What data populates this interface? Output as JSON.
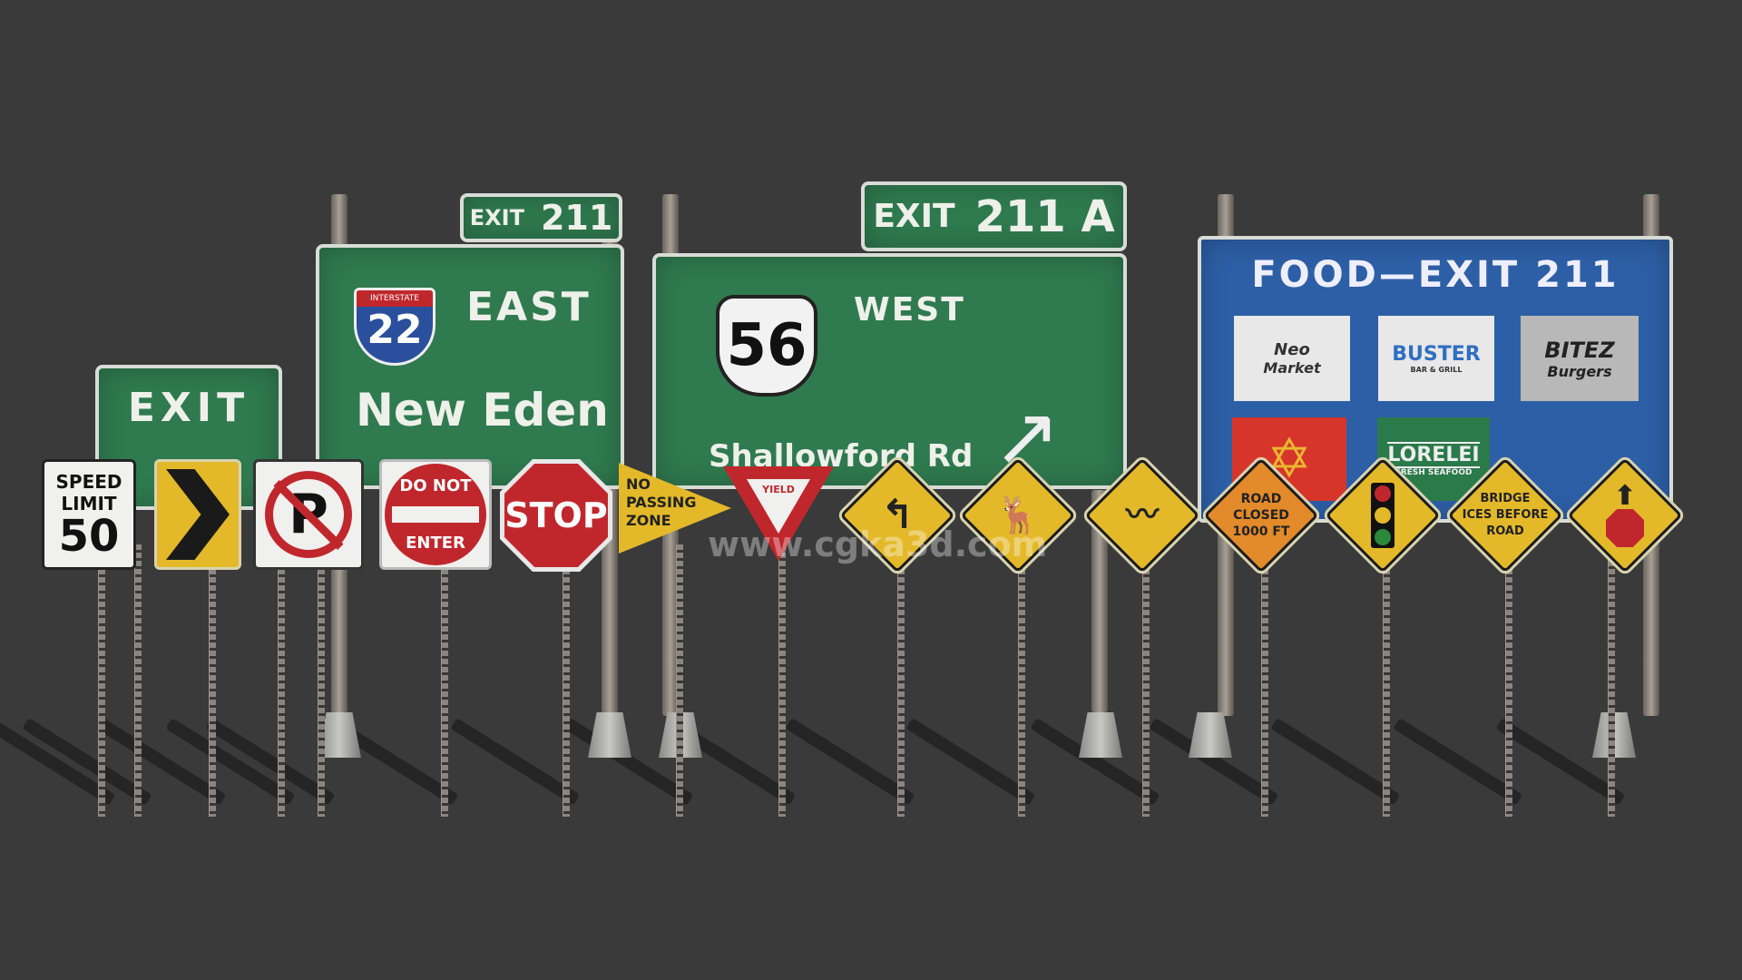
{
  "signs": {
    "exit_small": "EXIT",
    "east": {
      "tab": "EXIT",
      "tab_num": "211",
      "shield_top": "INTERSTATE",
      "shield_num": "22",
      "direction": "EAST",
      "destination": "New Eden"
    },
    "west": {
      "tab": "EXIT",
      "tab_num": "211 A",
      "shield_num": "56",
      "direction": "WEST",
      "destination": "Shallowford Rd"
    },
    "food": {
      "title": "FOOD—EXIT 211",
      "logos": [
        {
          "name": "Neo",
          "sub": "Market"
        },
        {
          "name": "BUSTER",
          "sub": "BAR & GRILL"
        },
        {
          "name": "BITEZ",
          "sub": "Burgers"
        },
        {
          "name": "",
          "sub": ""
        },
        {
          "name": "LORELEI",
          "sub": "FRESH SEAFOOD"
        }
      ]
    },
    "speed": {
      "line1": "SPEED",
      "line2": "LIMIT",
      "value": "50"
    },
    "no_parking": "P",
    "do_not_enter": {
      "line1": "DO NOT",
      "line2": "ENTER"
    },
    "stop": "STOP",
    "no_passing": {
      "line1": "NO",
      "line2": "PASSING",
      "line3": "ZONE"
    },
    "yield": "YIELD",
    "road_closed": {
      "line1": "ROAD",
      "line2": "CLOSED",
      "line3": "1000 FT"
    },
    "bridge": {
      "line1": "BRIDGE",
      "line2": "ICES BEFORE",
      "line3": "ROAD"
    }
  },
  "watermark": "www.cgka3d.com",
  "colors": {
    "background": "#3a3a3a",
    "guide_green": "#2f7a4f",
    "service_blue": "#2d5fa6",
    "warning_yellow": "#e3b92a",
    "regulatory_red": "#c0272d"
  }
}
